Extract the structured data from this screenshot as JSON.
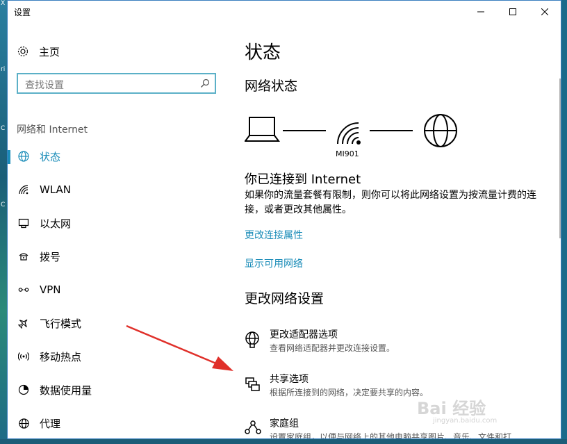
{
  "window": {
    "title": "设置"
  },
  "sidebar": {
    "home_label": "主页",
    "search_placeholder": "查找设置",
    "section_label": "网络和 Internet",
    "items": [
      {
        "label": "状态",
        "icon": "globe-icon",
        "active": true
      },
      {
        "label": "WLAN",
        "icon": "wifi-icon"
      },
      {
        "label": "以太网",
        "icon": "ethernet-icon"
      },
      {
        "label": "拨号",
        "icon": "dialup-icon"
      },
      {
        "label": "VPN",
        "icon": "vpn-icon"
      },
      {
        "label": "飞行模式",
        "icon": "airplane-icon"
      },
      {
        "label": "移动热点",
        "icon": "hotspot-icon"
      },
      {
        "label": "数据使用量",
        "icon": "data-usage-icon"
      },
      {
        "label": "代理",
        "icon": "globe-icon"
      }
    ]
  },
  "main": {
    "page_title": "状态",
    "network_status_heading": "网络状态",
    "network_name": "MI901",
    "connected_heading": "你已连接到 Internet",
    "connected_desc": "如果你的流量套餐有限制，则你可以将此网络设置为按流量计费的连接，或者更改其他属性。",
    "link_change_props": "更改连接属性",
    "link_show_networks": "显示可用网络",
    "change_settings_heading": "更改网络设置",
    "settings": [
      {
        "title": "更改适配器选项",
        "desc": "查看网络适配器并更改连接设置。",
        "icon": "adapter-globe-icon"
      },
      {
        "title": "共享选项",
        "desc": "根据所连接到的网络，决定要共享的内容。",
        "icon": "sharing-icon"
      },
      {
        "title": "家庭组",
        "desc": "设置家庭组，以便与网络上的其他电脑共享图片、音乐、文件和打",
        "icon": "homegroup-icon"
      }
    ]
  },
  "watermark": {
    "text": "Bai 经验",
    "url": "jingyan.baidu.com"
  },
  "colors": {
    "accent": "#1a8cb8",
    "search_border": "#5bb0c7",
    "annotation_arrow": "#e0302a"
  }
}
